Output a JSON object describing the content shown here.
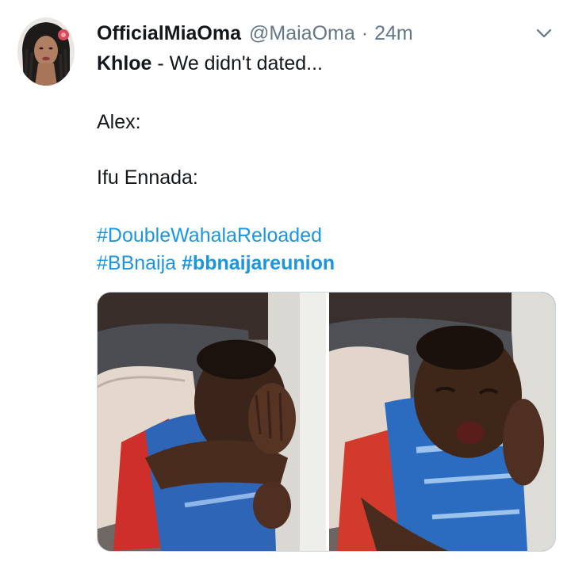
{
  "tweet": {
    "display_name": "OfficialMiaOma",
    "handle": "@MaiaOma",
    "separator": "·",
    "time": "24m",
    "avatar_icon": "user-avatar",
    "menu_icon": "chevron-down-icon",
    "body": {
      "line1_name": "Khloe",
      "line1_rest": " - We didn't dated...",
      "line2": "Alex:",
      "line3": "Ifu Ennada:",
      "hashtags_line1": "#DoubleWahalaReloaded",
      "hashtags_line2_a": "#BBnaija",
      "hashtags_line2_b": "#bbnaijareunion"
    },
    "media": {
      "count": 2,
      "images": [
        {
          "description": "crying baby covering face with hand"
        },
        {
          "description": "crying baby with hand on cheek"
        }
      ]
    }
  },
  "colors": {
    "text": "#14171a",
    "secondary": "#657786",
    "link": "#1b95e0",
    "border": "#ccd6dd"
  }
}
